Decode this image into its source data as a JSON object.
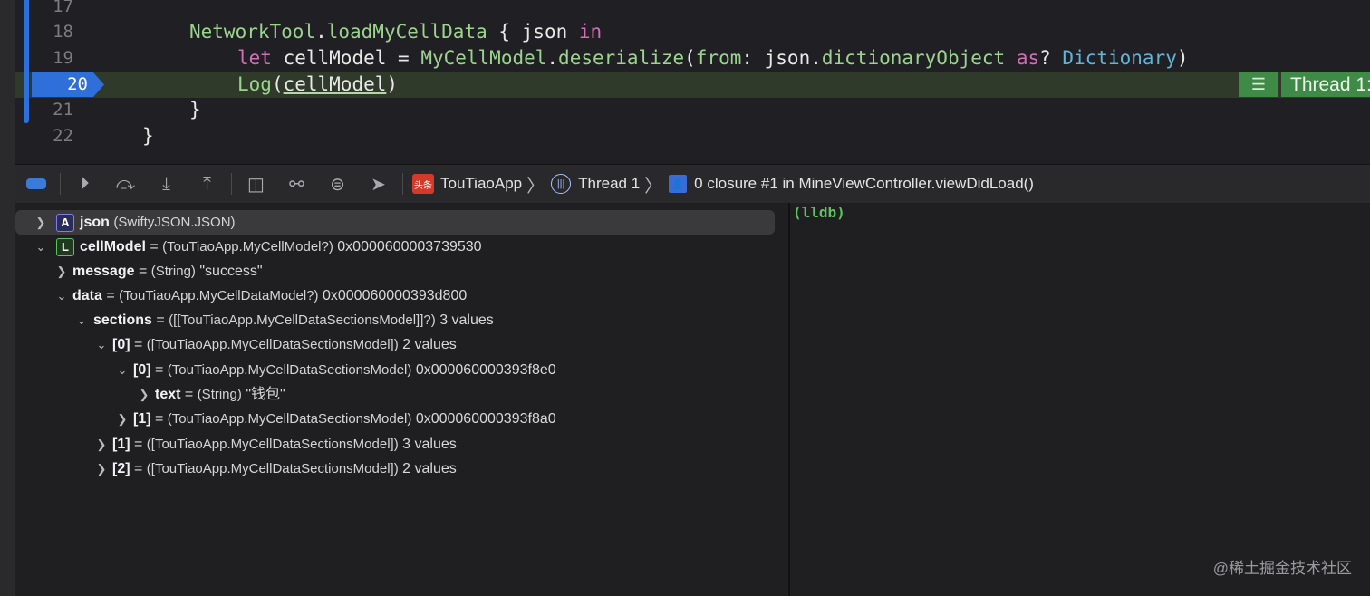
{
  "editor": {
    "lines": [
      {
        "number": "17"
      },
      {
        "number": "18",
        "tokens": [
          "NetworkTool",
          ".",
          "loadMyCellData",
          " { json ",
          "in"
        ]
      },
      {
        "number": "19",
        "tokens": [
          "let",
          " cellModel = ",
          "MyCellModel",
          ".",
          "deserialize",
          "(",
          "from",
          ": json.",
          "dictionaryObject",
          " ",
          "as",
          "? ",
          "Dictionary",
          ")"
        ]
      },
      {
        "number": "20",
        "tokens": [
          "Log",
          "(",
          "cellModel",
          ")"
        ]
      },
      {
        "number": "21",
        "tokens": [
          "}"
        ]
      },
      {
        "number": "22",
        "tokens": [
          "}"
        ]
      }
    ],
    "current_line": "20",
    "thread_indicator": "Thread 1:"
  },
  "debug_bar": {
    "app_icon_text": "头条",
    "app_name": "TouTiaoApp",
    "thread": "Thread 1",
    "frame": "0 closure #1 in MineViewController.viewDidLoad()"
  },
  "variables": [
    {
      "badge": "A",
      "name": "json",
      "type": "(SwiftyJSON.JSON)",
      "value": ""
    },
    {
      "badge": "L",
      "name": "cellModel",
      "type": "(TouTiaoApp.MyCellModel?)",
      "value": "0x0000600003739530"
    },
    {
      "name": "message",
      "type": "(String)",
      "value": "\"success\""
    },
    {
      "name": "data",
      "type": "(TouTiaoApp.MyCellDataModel?)",
      "value": "0x000060000393d800"
    },
    {
      "name": "sections",
      "type": "([[TouTiaoApp.MyCellDataSectionsModel]]?)",
      "value": "3 values"
    },
    {
      "name": "[0]",
      "type": "([TouTiaoApp.MyCellDataSectionsModel])",
      "value": "2 values"
    },
    {
      "name": "[0]",
      "type": "(TouTiaoApp.MyCellDataSectionsModel)",
      "value": "0x000060000393f8e0"
    },
    {
      "name": "text",
      "type": "(String)",
      "value": "\"钱包\""
    },
    {
      "name": "[1]",
      "type": "(TouTiaoApp.MyCellDataSectionsModel)",
      "value": "0x000060000393f8a0"
    },
    {
      "name": "[1]",
      "type": "([TouTiaoApp.MyCellDataSectionsModel])",
      "value": "3 values"
    },
    {
      "name": "[2]",
      "type": "([TouTiaoApp.MyCellDataSectionsModel])",
      "value": "2 values"
    }
  ],
  "console": {
    "prompt": "(lldb)"
  },
  "watermark": "@稀土掘金技术社区",
  "colors": {
    "accent": "#2f6fd9",
    "current_line": "#2f3a2b",
    "thread_green": "#3f8a47",
    "lldb_green": "#5fc25f",
    "type_green": "#9cd38e",
    "keyword_pink": "#d26fb5",
    "system_blue": "#61b4d8"
  }
}
